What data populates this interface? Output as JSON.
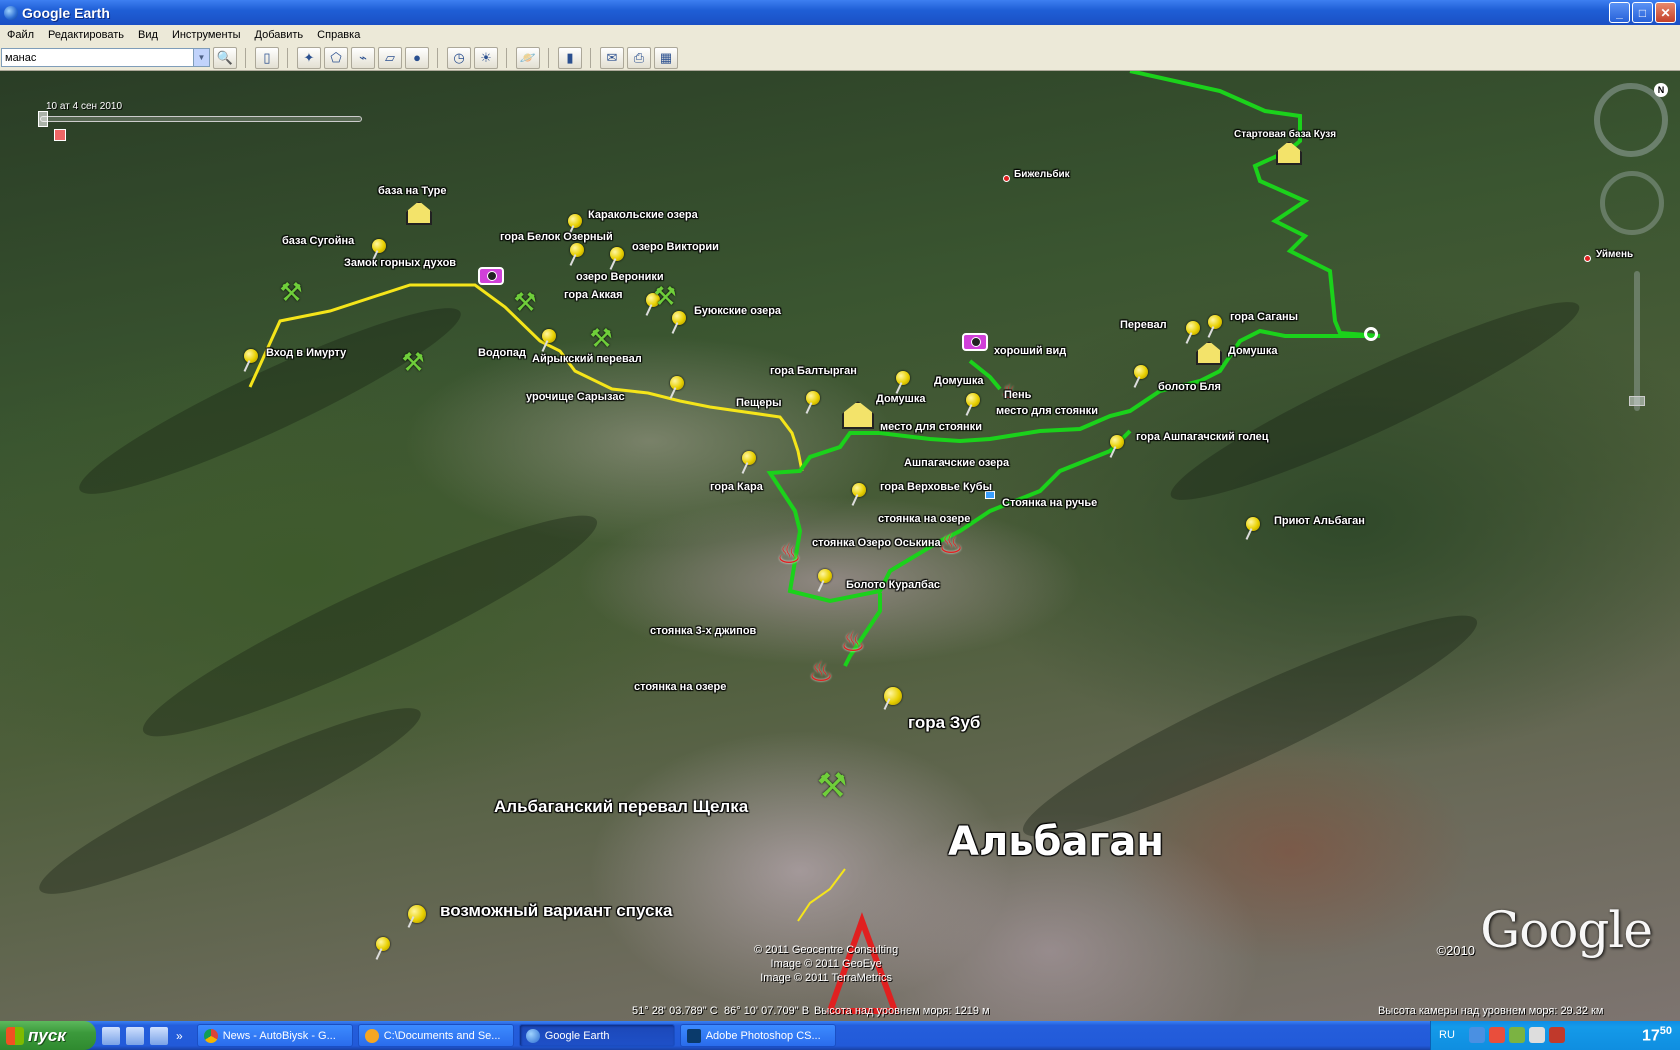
{
  "window": {
    "title": "Google Earth",
    "buttons": {
      "minimize": "_",
      "maximize": "□",
      "close": "✕"
    }
  },
  "menu": [
    "Файл",
    "Редактировать",
    "Вид",
    "Инструменты",
    "Добавить",
    "Справка"
  ],
  "search": {
    "value": "манас"
  },
  "toolbar_icons": [
    "search-icon",
    "sidebar-icon",
    "placemark-icon",
    "polygon-icon",
    "path-icon",
    "overlay-icon",
    "tour-icon",
    "history-icon",
    "sun-icon",
    "planets-icon",
    "ruler-icon",
    "email-icon",
    "print-icon",
    "maps-icon"
  ],
  "time_slider": {
    "label": "10 ат  4 сен 2010"
  },
  "labels": {
    "baza_na_ture": "база на Туре",
    "karakolskie": "Каракольские озера",
    "gora_belok": "гора Белок Озерный",
    "baza_sugoyna": "база Сугойна",
    "ozero_viktorii": "озеро Виктории",
    "zamok": "Замок горных духов",
    "ozero_veroniki": "озеро Вероники",
    "gora_akkaya": "гора Аккая",
    "buyukskie": "Буюкские озера",
    "vhod_v_imurtu": "Вход в Имурту",
    "vodopad": "Водопад",
    "ayrykskiy": "Айрыкский перевал",
    "urochishche": "урочище Сарызас",
    "peshchery": "Пещеры",
    "gora_baltyrgan": "гора Балтырган",
    "domushka1": "Домушка",
    "domushka2": "Домушка",
    "domushka3": "Домушка",
    "pen": "Пень",
    "mesto1": "место для стоянки",
    "mesto2": "место для стоянки",
    "khoroshiy_vid": "хороший вид",
    "pereval": "Перевал",
    "gora_sagany": "гора Саганы",
    "boloto_blya": "болото Бля",
    "gora_ashpagachskiy": "гора Ашпагачский голец",
    "ashpagachskie": "Ашпагачские озера",
    "gora_kara": "гора Кара",
    "gora_verkhovye": "гора Верховье Кубы",
    "stoyanka_na_ruchye": "Стоянка на ручье",
    "stoyanka_na_ozere1": "стоянка на озере",
    "stoyanka_oskina": "стоянка Озеро Оськина",
    "priyut": "Приют Альбаган",
    "boloto_kuralbas": "Болото Куралбас",
    "stoyanka_3_dzhipov": "стоянка 3-х джипов",
    "stoyanka_na_ozere2": "стоянка на озере",
    "gora_zub": "гора Зуб",
    "albaganskiy": "Альбаганский перевал Щелка",
    "albagan": "Альбаган",
    "vozmozhnyy": "возможный вариант спуска",
    "startovaya": "Стартовая база Кузя",
    "bizhelbik": "Бижельбик",
    "uymen": "Уймень"
  },
  "copyright": [
    "© 2011 Geocentre Consulting",
    "Image © 2011 GeoEye",
    "Image © 2011 TerraMetrics"
  ],
  "google_logo": "Google",
  "google_year": "©2010",
  "status": {
    "lat": "51° 28' 03.789\" С",
    "lon": "86° 10' 07.709\" В",
    "elevation": "Высота над уровнем моря:  1219 м",
    "camera": "Высота камеры над уровнем моря:   29.32 км"
  },
  "taskbar": {
    "start": "пуск",
    "tasks": [
      "News - AutoBiysk - G...",
      "C:\\Documents and Se...",
      "Google Earth",
      "Adobe Photoshop CS..."
    ],
    "active_task": 2,
    "lang": "RU",
    "clock": "17",
    "clock_min": "50"
  },
  "colors": {
    "route_yellow": "#f5e51a",
    "route_green": "#1bd21b",
    "fire_red": "#e02020",
    "taskbar_blue": "#245edc"
  }
}
